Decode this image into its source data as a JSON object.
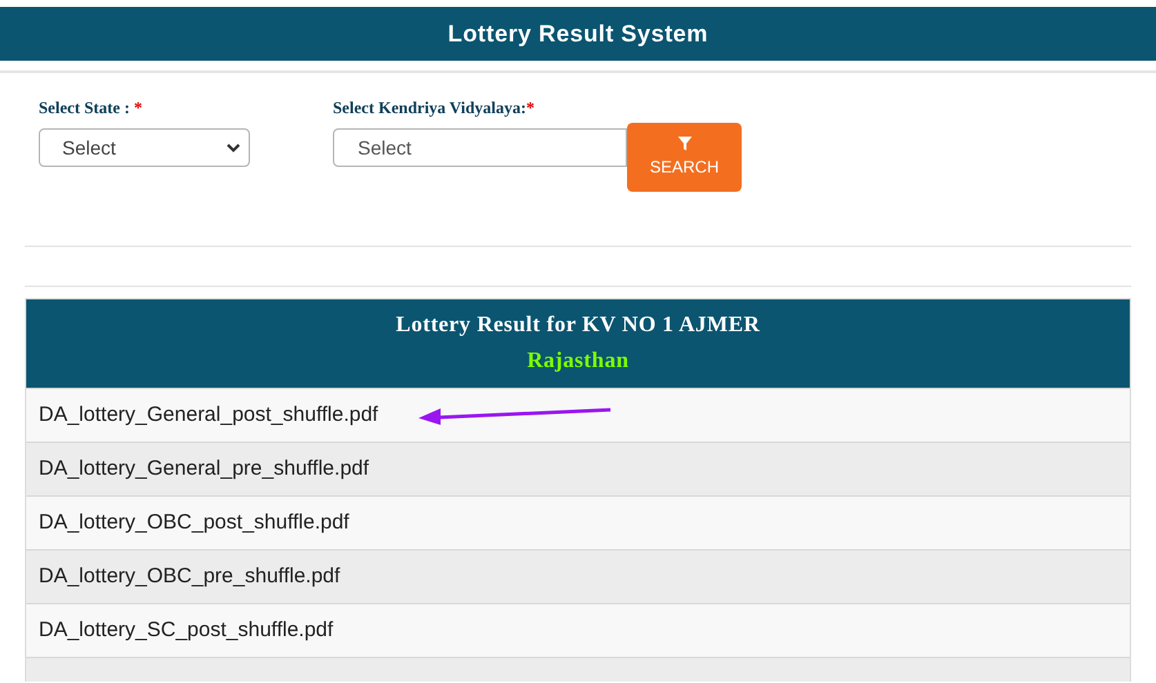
{
  "header": {
    "title": "Lottery Result System"
  },
  "filters": [
    {
      "label": "Select State : ",
      "required_mark": "*",
      "placeholder": "Select",
      "kind": "dropdown"
    },
    {
      "label": "Select Kendriya Vidyalaya:",
      "required_mark": "*",
      "placeholder": "Select",
      "kind": "field"
    }
  ],
  "search_button": {
    "label": "SEARCH"
  },
  "result": {
    "title": "Lottery Result for KV NO 1 AJMER",
    "subtitle": "Rajasthan",
    "files": [
      "DA_lottery_General_post_shuffle.pdf",
      "DA_lottery_General_pre_shuffle.pdf",
      "DA_lottery_OBC_post_shuffle.pdf",
      "DA_lottery_OBC_pre_shuffle.pdf",
      "DA_lottery_SC_post_shuffle.pdf"
    ]
  }
}
